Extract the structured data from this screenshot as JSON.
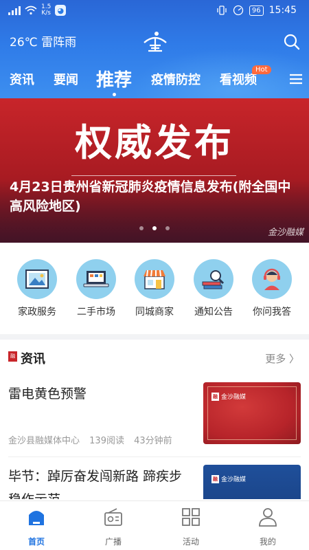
{
  "status_bar": {
    "speed": "1.5\nK/s",
    "battery": "96",
    "time": "15:45"
  },
  "header": {
    "weather": "26℃ 雷阵雨",
    "logo_text": "金"
  },
  "tabs": [
    {
      "label": "资讯",
      "active": false
    },
    {
      "label": "要闻",
      "active": false
    },
    {
      "label": "推荐",
      "active": true
    },
    {
      "label": "疫情防控",
      "active": false
    },
    {
      "label": "看视频",
      "active": false
    }
  ],
  "hot_badge": "Hot",
  "banner": {
    "title": "权威发布",
    "headline": "4月23日贵州省新冠肺炎疫情信息发布(附全国中高风险地区)",
    "watermark": "金沙融媒",
    "dots": 3,
    "active_dot": 2
  },
  "services": [
    {
      "label": "家政服务",
      "icon": "picture-icon"
    },
    {
      "label": "二手市场",
      "icon": "laptop-icon"
    },
    {
      "label": "同城商家",
      "icon": "storefront-icon"
    },
    {
      "label": "通知公告",
      "icon": "books-search-icon"
    },
    {
      "label": "你问我答",
      "icon": "support-agent-icon"
    }
  ],
  "news": {
    "section_title": "资讯",
    "more": "更多",
    "items": [
      {
        "title": "雷电黄色预警",
        "source": "金沙县融媒体中心",
        "reads": "139阅读",
        "time": "43分钟前",
        "thumb_tag": "金沙融媒"
      },
      {
        "title": "毕节：踔厉奋发闯新路 蹄疾步稳作示范",
        "thumb_tag": "金沙融媒"
      }
    ]
  },
  "bottom_nav": [
    {
      "label": "首页",
      "active": true
    },
    {
      "label": "广播",
      "active": false
    },
    {
      "label": "活动",
      "active": false
    },
    {
      "label": "我的",
      "active": false
    }
  ],
  "colors": {
    "accent": "#1f73e0",
    "banner_red": "#c8252a",
    "hot": "#ff6a3d"
  }
}
